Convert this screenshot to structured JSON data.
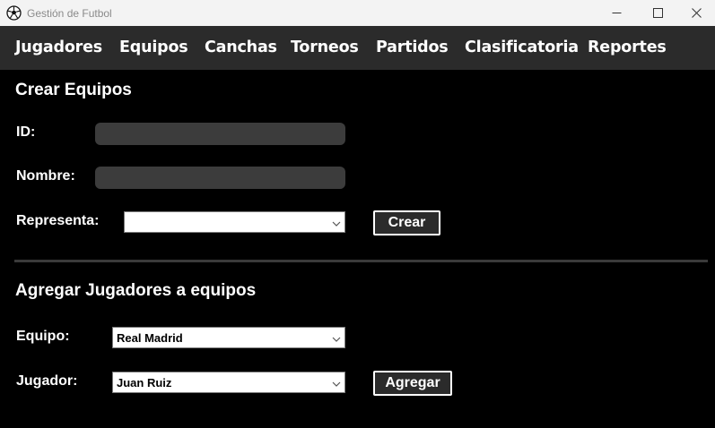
{
  "window": {
    "title": "Gestión de Futbol",
    "app_icon": "soccer-ball-icon",
    "controls": [
      "minimize-icon",
      "maximize-icon",
      "close-icon"
    ]
  },
  "menu": {
    "items": [
      "Jugadores",
      "Equipos",
      "Canchas",
      "Torneos",
      "Partidos",
      "Clasificatoria",
      "Reportes"
    ]
  },
  "create_team": {
    "title": "Crear Equipos",
    "id_label": "ID:",
    "id_value": "",
    "name_label": "Nombre:",
    "name_value": "",
    "represents_label": "Representa:",
    "represents_value": "",
    "create_button": "Crear"
  },
  "add_players": {
    "title": "Agregar Jugadores a equipos",
    "team_label": "Equipo:",
    "team_value": "Real Madrid",
    "player_label": "Jugador:",
    "player_value": "Juan Ruiz",
    "add_button": "Agregar"
  },
  "colors": {
    "background": "#000000",
    "menubar": "#2b2b2b",
    "titlebar": "#f3f3f3",
    "textbox": "#3c3c3c",
    "text": "#ffffff"
  }
}
